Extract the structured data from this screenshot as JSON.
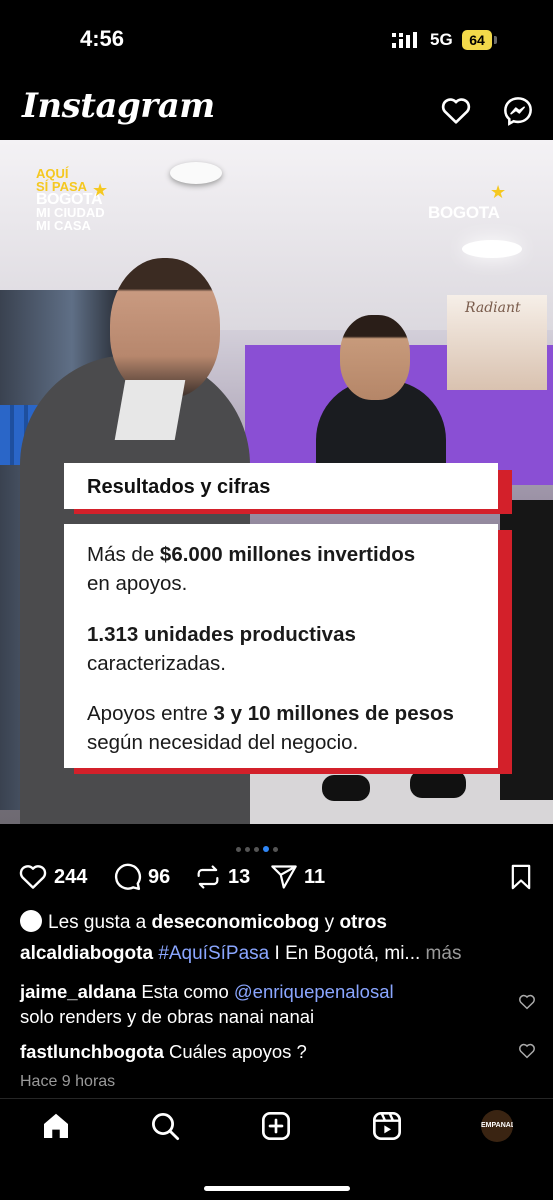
{
  "status_bar": {
    "time": "4:56",
    "network": "5G",
    "battery": "64"
  },
  "header": {
    "app_title": "Instagram",
    "notifications_icon": "heart-icon",
    "messages_icon": "messenger-icon"
  },
  "post": {
    "brand_left": {
      "l1": "AQUÍ",
      "l2": "SÍ PASA",
      "l3": "BOGOTA",
      "l4": "MI CIUDAD",
      "l5": "MI CASA"
    },
    "brand_right": "BOGOTA",
    "poster_title": "Radiant",
    "card_title": "Resultados y cifras",
    "stats": [
      {
        "line1_pre": "Más de ",
        "line1_bold": "$6.000 millones invertidos",
        "line2": "en apoyos."
      },
      {
        "line1_pre": "",
        "line1_bold": "1.313 unidades productivas",
        "line2": "caracterizadas."
      },
      {
        "line1_pre": "Apoyos entre ",
        "line1_bold": "3 y 10 millones de pesos",
        "line2": "según necesidad del negocio."
      }
    ],
    "carousel": {
      "count": 4,
      "active": 3
    },
    "actions": {
      "likes": "244",
      "comments": "96",
      "reposts": "13",
      "shares": "11"
    },
    "liked_by": {
      "prefix": "Les gusta a ",
      "user": "deseconomicobog",
      "mid": " y ",
      "others": "otros"
    },
    "caption": {
      "user": "alcaldiabogota",
      "hashtag": "#AquíSíPasa",
      "text": " I En Bogotá, mi...",
      "more": " más"
    },
    "comments": [
      {
        "user": "jaime_aldana",
        "text": " Esta como ",
        "mention": "@enriquepenalosal",
        "line2": "solo renders y de obras nanai nanai"
      },
      {
        "user": "fastlunchbogota",
        "text": " Cuáles apoyos ?"
      }
    ],
    "time_ago": "Hace 9 horas"
  },
  "nav": {
    "profile_label": "EMPANADAS"
  },
  "colors": {
    "accent_red": "#d3202a",
    "brand_yellow": "#f5c820",
    "link_blue": "#8aa6ff",
    "carousel_active": "#2f86f6"
  }
}
